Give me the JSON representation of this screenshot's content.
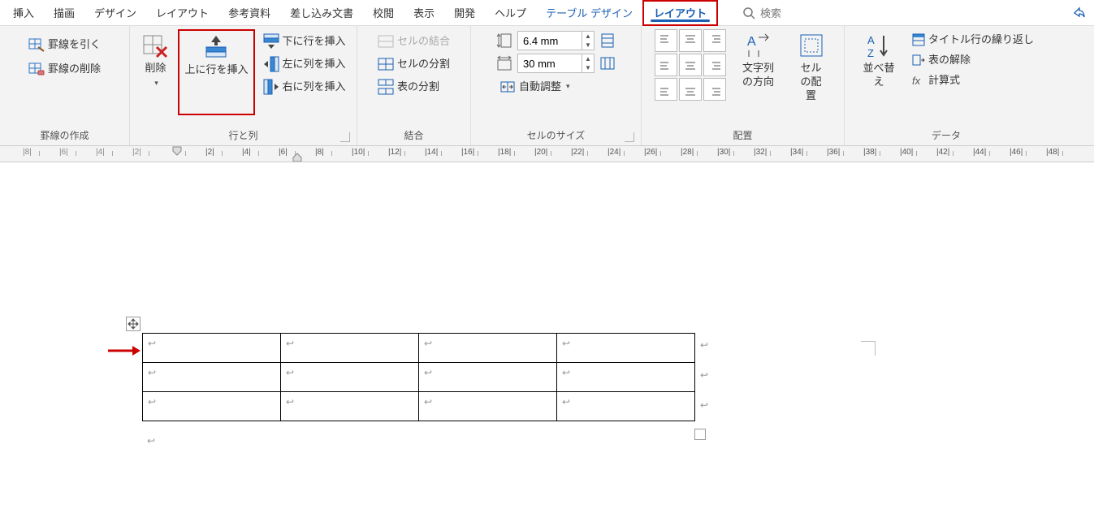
{
  "tabs": {
    "insert": "挿入",
    "draw": "描画",
    "design": "デザイン",
    "layout": "レイアウト",
    "reference": "参考資料",
    "mailings": "差し込み文書",
    "review": "校閲",
    "view": "表示",
    "developer": "開発",
    "help": "ヘルプ",
    "table_design": "テーブル デザイン",
    "table_layout": "レイアウト"
  },
  "search": {
    "placeholder": "検索"
  },
  "ribbon": {
    "borders": {
      "draw": "罫線を引く",
      "erase": "罫線の削除",
      "group": "罫線の作成"
    },
    "rows_cols": {
      "delete": "削除",
      "insert_above": "上に行を挿入",
      "insert_below": "下に行を挿入",
      "insert_left": "左に列を挿入",
      "insert_right": "右に列を挿入",
      "group": "行と列"
    },
    "merge": {
      "merge": "セルの結合",
      "split": "セルの分割",
      "split_table": "表の分割",
      "group": "結合"
    },
    "size": {
      "height_value": "6.4 mm",
      "width_value": "30 mm",
      "autofit": "自動調整",
      "group": "セルのサイズ"
    },
    "alignment": {
      "text_dir": "文字列の方向",
      "cell_margins": "セルの配置",
      "group": "配置"
    },
    "data": {
      "sort": "並べ替え",
      "repeat_header": "タイトル行の繰り返し",
      "convert": "表の解除",
      "formula": "計算式",
      "group": "データ"
    }
  },
  "ruler": {
    "ticks": [
      "8",
      "6",
      "4",
      "2",
      "",
      "2",
      "4",
      "6",
      "8",
      "10",
      "12",
      "14",
      "16",
      "18",
      "20",
      "22",
      "24",
      "26",
      "28",
      "30",
      "32",
      "34",
      "36",
      "38",
      "40",
      "42",
      "44",
      "46",
      "48"
    ]
  },
  "table": {
    "rows": 3,
    "cols": 4,
    "cell_marker": "↩"
  }
}
